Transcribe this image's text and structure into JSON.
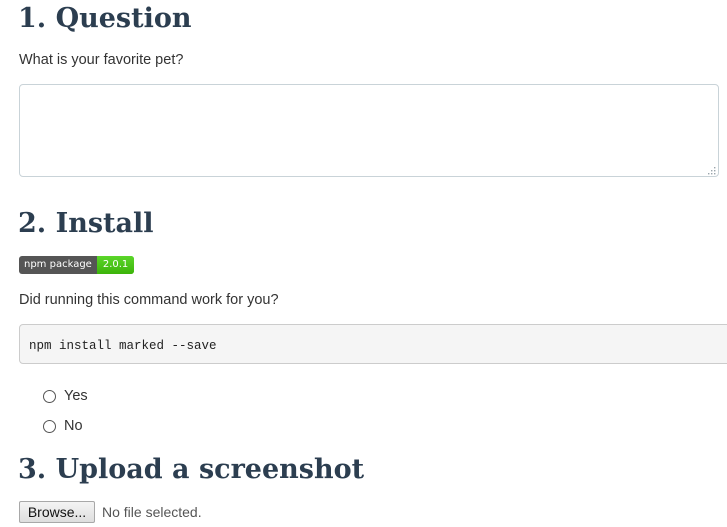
{
  "section1": {
    "heading": "1. Question",
    "question": "What is your favorite pet?",
    "answer_value": ""
  },
  "section2": {
    "heading": "2. Install",
    "badge": {
      "label": "npm package",
      "version": "2.0.1",
      "label_color": "#555555",
      "version_color": "#44cc11"
    },
    "question": "Did running this command work for you?",
    "command": "npm install marked --save",
    "options": [
      {
        "label": "Yes",
        "selected": false
      },
      {
        "label": "No",
        "selected": false
      }
    ]
  },
  "section3": {
    "heading": "3. Upload a screenshot",
    "browse_label": "Browse...",
    "file_status": "No file selected."
  },
  "colors": {
    "heading": "#2c3e50",
    "text": "#333333",
    "code_background": "#f5f5f5"
  }
}
